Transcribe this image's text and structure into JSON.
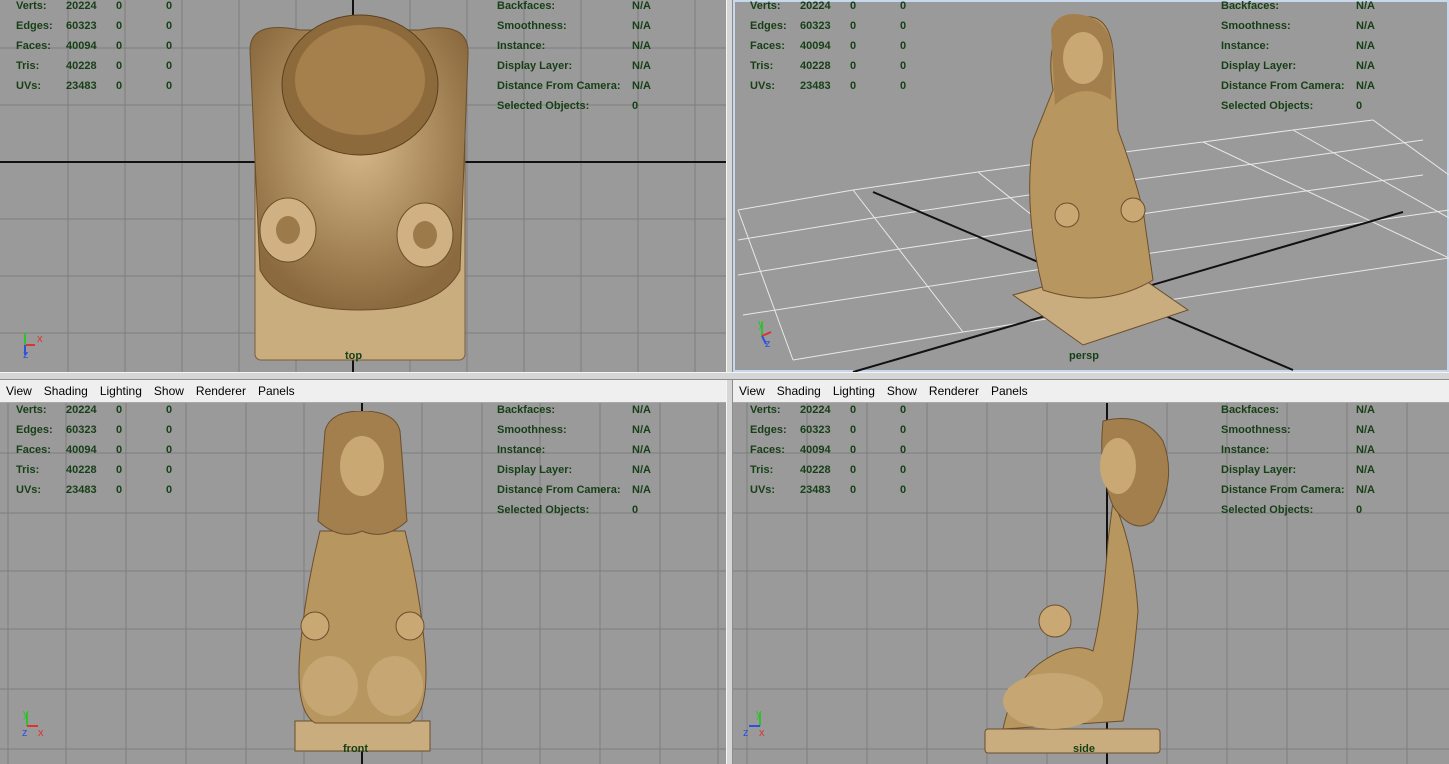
{
  "menu": [
    "View",
    "Shading",
    "Lighting",
    "Show",
    "Renderer",
    "Panels"
  ],
  "hud_left": [
    {
      "label": "Verts:",
      "v1": "20224",
      "v2": "0",
      "v3": "0"
    },
    {
      "label": "Edges:",
      "v1": "60323",
      "v2": "0",
      "v3": "0"
    },
    {
      "label": "Faces:",
      "v1": "40094",
      "v2": "0",
      "v3": "0"
    },
    {
      "label": "Tris:",
      "v1": "40228",
      "v2": "0",
      "v3": "0"
    },
    {
      "label": "UVs:",
      "v1": "23483",
      "v2": "0",
      "v3": "0"
    }
  ],
  "hud_right": [
    {
      "label": "Backfaces:",
      "val": "N/A"
    },
    {
      "label": "Smoothness:",
      "val": "N/A"
    },
    {
      "label": "Instance:",
      "val": "N/A"
    },
    {
      "label": "Display Layer:",
      "val": "N/A"
    },
    {
      "label": "Distance From Camera:",
      "val": "N/A"
    },
    {
      "label": "Selected Objects:",
      "val": "0"
    }
  ],
  "viewports": {
    "top": {
      "camera": "top"
    },
    "persp": {
      "camera": "persp"
    },
    "front": {
      "camera": "front"
    },
    "side": {
      "camera": "side"
    }
  },
  "axes": {
    "x": "x",
    "y": "y",
    "z": "z",
    "x_color": "#e03030",
    "y_color": "#30c030",
    "z_color": "#3050e0"
  },
  "colors": {
    "viewport_bg": "#9a9a9a",
    "hud_text": "#163f16",
    "statue": "#b89660"
  }
}
